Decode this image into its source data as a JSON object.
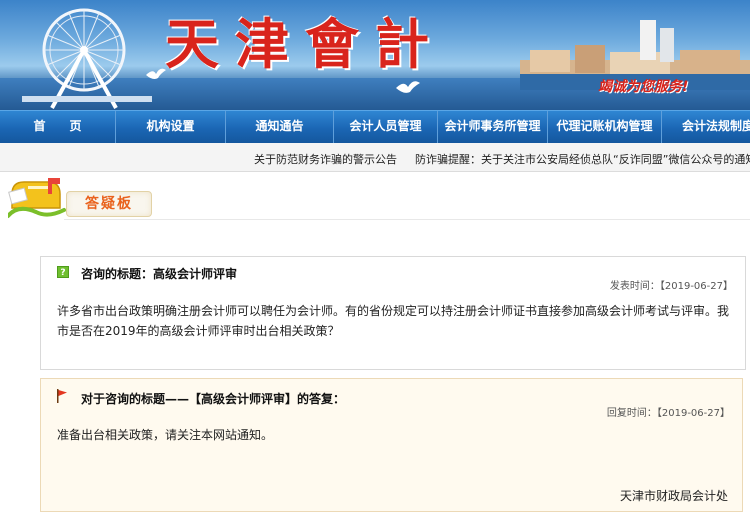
{
  "banner": {
    "title": "天津會計",
    "slogan": "竭诚为您服务!"
  },
  "nav": {
    "items": [
      {
        "label": "首　　页"
      },
      {
        "label": "机构设置"
      },
      {
        "label": "通知通告"
      },
      {
        "label": "会计人员管理"
      },
      {
        "label": "会计师事务所管理"
      },
      {
        "label": "代理记账机构管理"
      },
      {
        "label": "会计法规制度"
      }
    ]
  },
  "ticker": {
    "items": [
      "关于防范财务诈骗的警示公告",
      "防诈骗提醒：关于关注市公安局经侦总队“反诈同盟”微信公众号的通知"
    ]
  },
  "board": {
    "label": "答疑板",
    "icons": {
      "mailbox": "mailbox-icon"
    }
  },
  "question": {
    "icon": "question-icon",
    "heading": "咨询的标题：高级会计师评审",
    "time_label": "发表时间：",
    "time_value": "【2019-06-27】",
    "body": "许多省市出台政策明确注册会计师可以聘任为会计师。有的省份规定可以持注册会计师证书直接参加高级会计师考试与评审。我市是否在2019年的高级会计师评审时出台相关政策？"
  },
  "answer": {
    "icon": "flag-icon",
    "heading": "对于咨询的标题——【高级会计师评审】的答复：",
    "time_label": "回复时间：",
    "time_value": "【2019-06-27】",
    "body": "准备出台相关政策，请关注本网站通知。",
    "signature": "天津市财政局会计处"
  },
  "colors": {
    "nav_bg": "#1b66b4",
    "banner_red": "#d9241c",
    "board_label": "#e9621d",
    "answer_bg": "#fffaef"
  }
}
